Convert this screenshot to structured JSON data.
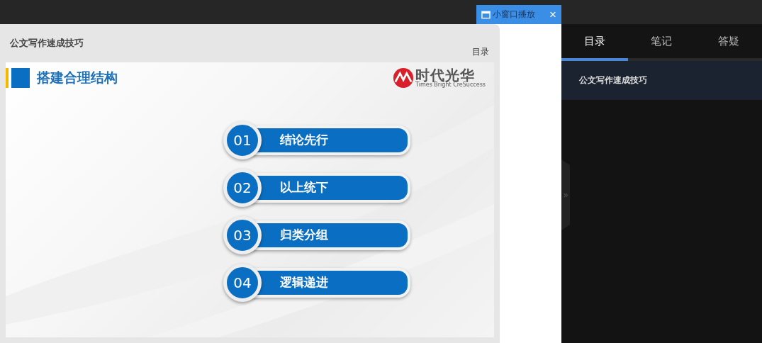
{
  "popup_button": {
    "label": "小窗口播放",
    "close": "×"
  },
  "player": {
    "course_title": "公文写作速成技巧",
    "toc_link": "目录",
    "slide": {
      "title": "搭建合理结构",
      "logo_name": "时代光华",
      "logo_tagline": "Times Bright CreSuccess",
      "items": [
        {
          "number": "01",
          "label": "结论先行"
        },
        {
          "number": "02",
          "label": "以上统下"
        },
        {
          "number": "03",
          "label": "归类分组"
        },
        {
          "number": "04",
          "label": "逻辑递进"
        }
      ]
    }
  },
  "sidebar": {
    "tabs": [
      {
        "label": "目录",
        "selected": true
      },
      {
        "label": "笔记",
        "selected": false
      },
      {
        "label": "答疑",
        "selected": false
      }
    ],
    "items": [
      {
        "label": "公文写作速成技巧"
      }
    ],
    "collapse_handle": "»"
  }
}
